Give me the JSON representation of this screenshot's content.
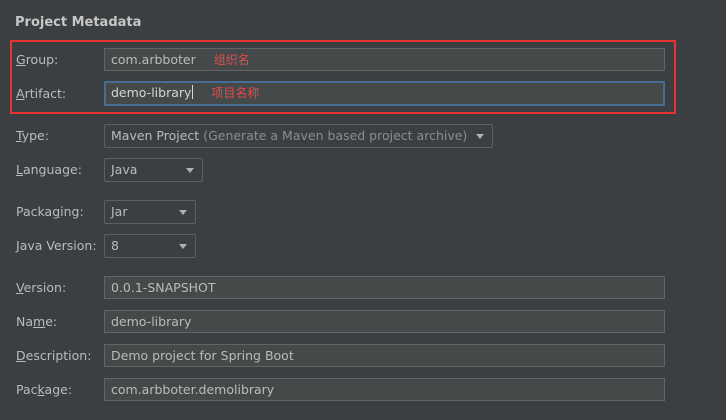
{
  "section_title": "Project Metadata",
  "group": {
    "label": "Group:",
    "mnemonic": "G",
    "rest": "roup:",
    "value": "com.arbboter",
    "annotation": "组织名"
  },
  "artifact": {
    "label": "Artifact:",
    "mnemonic": "A",
    "rest": "rtifact:",
    "value": "demo-library",
    "annotation": "项目名称"
  },
  "type": {
    "mnemonic": "T",
    "rest": "ype:",
    "value": "Maven Project",
    "hint": "(Generate a Maven based project archive)"
  },
  "language": {
    "mnemonic": "L",
    "rest": "anguage:",
    "value": "Java"
  },
  "packaging": {
    "pre": "Packa",
    "mnemonic": "g",
    "rest": "ing:",
    "value": "Jar"
  },
  "java_version": {
    "mnemonic": "J",
    "rest": "ava Version:",
    "value": "8"
  },
  "version": {
    "mnemonic": "V",
    "rest": "ersion:",
    "value": "0.0.1-SNAPSHOT"
  },
  "name": {
    "pre": "Na",
    "mnemonic": "m",
    "rest": "e:",
    "value": "demo-library"
  },
  "description": {
    "mnemonic": "D",
    "rest": "escription:",
    "value": "Demo project for Spring Boot"
  },
  "package": {
    "pre": "Pac",
    "mnemonic": "k",
    "rest": "age:",
    "value": "com.arbboter.demolibrary"
  },
  "colors": {
    "annotation": "#e24b4b",
    "highlight_box": "#e53333",
    "focus_border": "#466d94"
  }
}
